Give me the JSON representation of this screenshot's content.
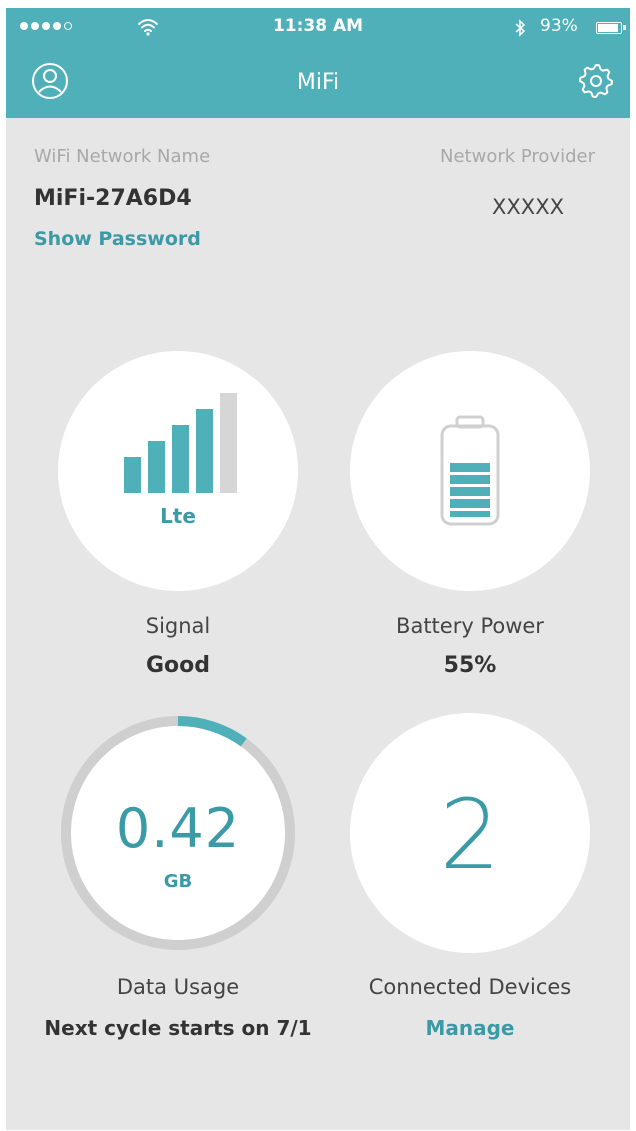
{
  "status_bar": {
    "time": "11:38 AM",
    "battery_percent_text": "93%",
    "battery_level": 0.93,
    "signal_dots_filled": 4,
    "signal_dots_total": 5,
    "icons": [
      "signal-dots-icon",
      "wifi-icon",
      "bluetooth-icon",
      "battery-icon"
    ]
  },
  "nav": {
    "title": "MiFi",
    "left_icon": "profile-icon",
    "right_icon": "gear-icon"
  },
  "network": {
    "wifi_label": "WiFi Network Name",
    "wifi_name": "MiFi-27A6D4",
    "show_password": "Show Password",
    "provider_label": "Network Provider",
    "provider_value": "XXXXX"
  },
  "signal": {
    "label": "Signal",
    "value": "Good",
    "technology": "Lte",
    "bars_filled": 4,
    "bars_total": 5,
    "icon": "signal-bars-icon"
  },
  "battery": {
    "label": "Battery Power",
    "value": "55%",
    "icon": "battery-level-icon"
  },
  "data_usage": {
    "label": "Data Usage",
    "amount": "0.42",
    "unit": "GB",
    "cycle_text": "Next cycle starts on 7/1",
    "usage_fraction": 0.1
  },
  "devices": {
    "label": "Connected Devices",
    "count": "2",
    "manage": "Manage"
  },
  "colors": {
    "accent": "#4fb0b9",
    "accent_text": "#3a9aa5",
    "background": "#e6e6e6",
    "ring_track": "#cfcfcf",
    "inactive_bar": "#d6d6d6"
  }
}
